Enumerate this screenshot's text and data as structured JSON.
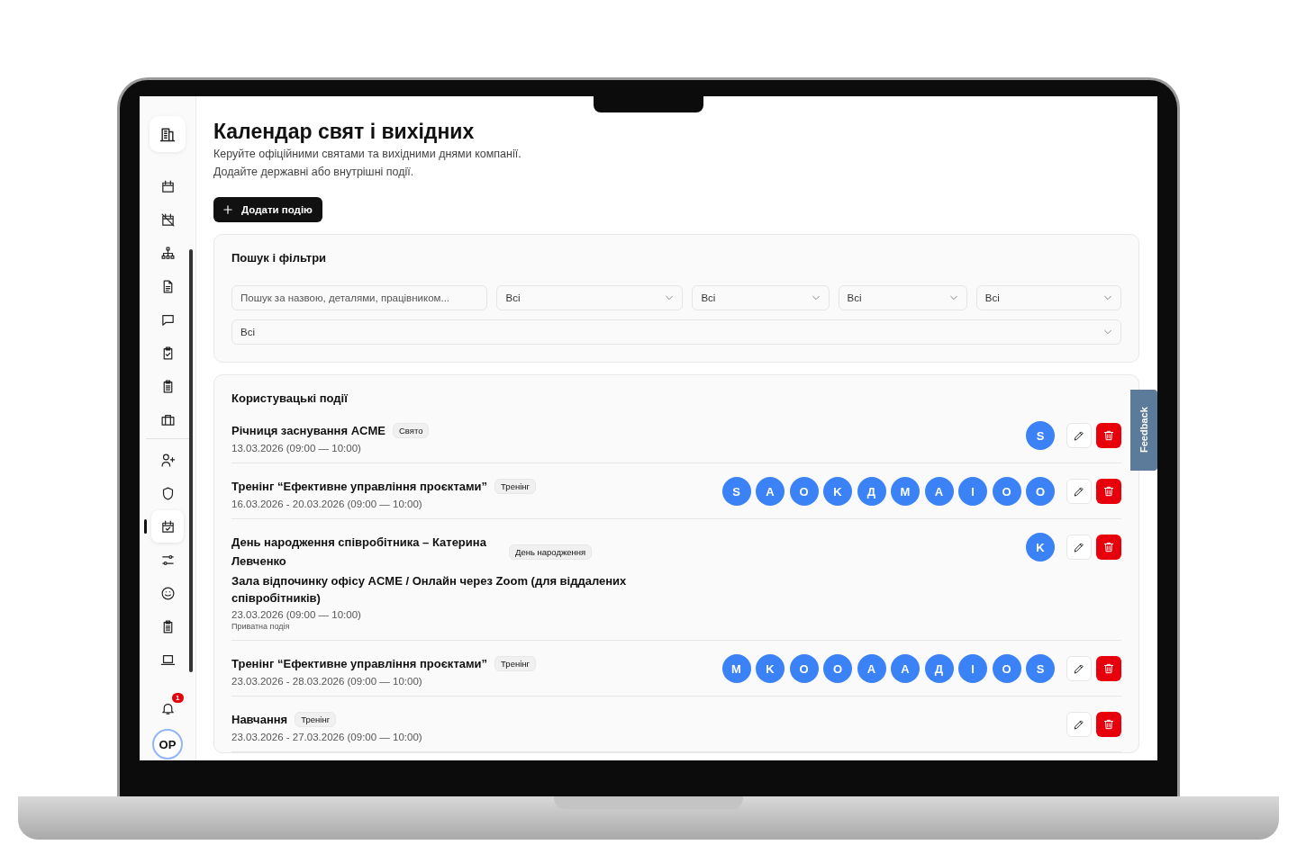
{
  "sidebar": {
    "groups": [
      [
        {
          "kind": "calendar",
          "selected": false
        },
        {
          "kind": "calendar-off",
          "selected": false
        },
        {
          "kind": "org-chart",
          "selected": false
        },
        {
          "kind": "document",
          "selected": false
        },
        {
          "kind": "chat",
          "selected": false
        },
        {
          "kind": "clipboard-check",
          "selected": false
        },
        {
          "kind": "clipboard-list",
          "selected": false
        },
        {
          "kind": "briefcase",
          "selected": false
        }
      ],
      [
        {
          "kind": "user-plus",
          "selected": false
        },
        {
          "kind": "shield",
          "selected": false
        },
        {
          "kind": "calendar-check",
          "selected": true
        },
        {
          "kind": "sliders",
          "selected": false
        },
        {
          "kind": "smiley",
          "selected": false
        },
        {
          "kind": "clipboard-list",
          "selected": false
        },
        {
          "kind": "laptop",
          "selected": false
        }
      ]
    ],
    "notifications": {
      "badge": "1"
    },
    "user": {
      "initials": "OP"
    }
  },
  "page": {
    "title": "Календар свят і вихідних",
    "subtitle": [
      "Керуйте офіційними святами та вихідними днями компанії.",
      "Додайте державні або внутрішні події."
    ],
    "add_button": "Додати подію"
  },
  "filters": {
    "title": "Пошук і фільтри",
    "search": {
      "placeholder": "Пошук за назвою, деталями, працівником..."
    },
    "selects": [
      "Всі",
      "Всі",
      "Всі",
      "Всі"
    ],
    "select_wide": "Всі"
  },
  "events": {
    "title": "Користувацькі події",
    "items": [
      {
        "title": "Річниця заснування ACME",
        "tag": "Свято",
        "date": "13.03.2026 (09:00 — 10:00)",
        "avatars": [
          "S"
        ]
      },
      {
        "title": "Тренінг “Ефективне управління проєктами”",
        "tag": "Тренінг",
        "date": "16.03.2026 - 20.03.2026 (09:00 — 10:00)",
        "avatars": [
          "S",
          "A",
          "O",
          "K",
          "Д",
          "M",
          "A",
          "I",
          "O",
          "O"
        ]
      },
      {
        "title": "День народження співробітника – Катерина Левченко",
        "tag": "День народження",
        "location": "Зала відпочинку офісу ACME / Онлайн через Zoom (для віддалених співробітників)",
        "date": "23.03.2026 (09:00 — 10:00)",
        "note": "Приватна подія",
        "avatars": [
          "K"
        ]
      },
      {
        "title": "Тренінг “Ефективне управління проєктами”",
        "tag": "Тренінг",
        "date": "23.03.2026 - 28.03.2026 (09:00 — 10:00)",
        "avatars": [
          "M",
          "K",
          "O",
          "O",
          "A",
          "A",
          "Д",
          "I",
          "O",
          "S"
        ]
      },
      {
        "title": "Навчання",
        "tag": "Тренінг",
        "date": "23.03.2026 - 27.03.2026 (09:00 — 10:00)"
      }
    ]
  },
  "feedback_tab": {
    "label": "Feedback"
  }
}
